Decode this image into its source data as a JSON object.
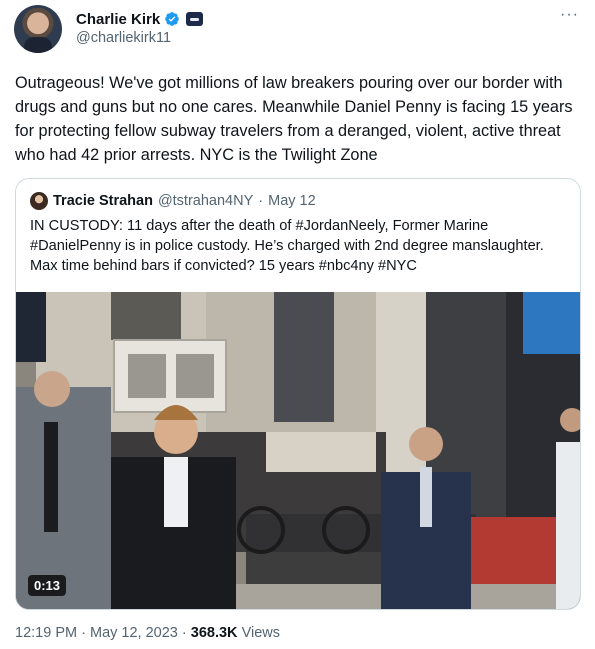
{
  "author": {
    "display_name": "Charlie Kirk",
    "handle": "@charliekirk11"
  },
  "more_label": "···",
  "tweet_text": "Outrageous! We've got millions of law breakers pouring over our border with drugs and guns but no one cares. Meanwhile Daniel Penny is facing 15 years for protecting fellow subway travelers from a deranged, violent, active threat who had 42 prior arrests. NYC is the Twilight Zone",
  "quoted": {
    "display_name": "Tracie Strahan",
    "handle": "@tstrahan4NY",
    "separator": "·",
    "date": "May 12",
    "text": "IN CUSTODY: 11 days after the death of #JordanNeely, Former Marine #DanielPenny is in police custody. He’s charged with 2nd degree manslaughter. Max time behind bars if convicted? 15 years #nbc4ny #NYC",
    "video_duration": "0:13"
  },
  "footer": {
    "time": "12:19 PM",
    "separator": "·",
    "date": "May 12, 2023",
    "views_count": "368.3K",
    "views_label": "Views"
  },
  "colors": {
    "verified_blue": "#1d9bf0",
    "secondary_text": "#536471",
    "border": "#cfd9de"
  },
  "icons": [
    "verified-badge-icon",
    "affiliate-badge-icon",
    "more-options-icon"
  ]
}
